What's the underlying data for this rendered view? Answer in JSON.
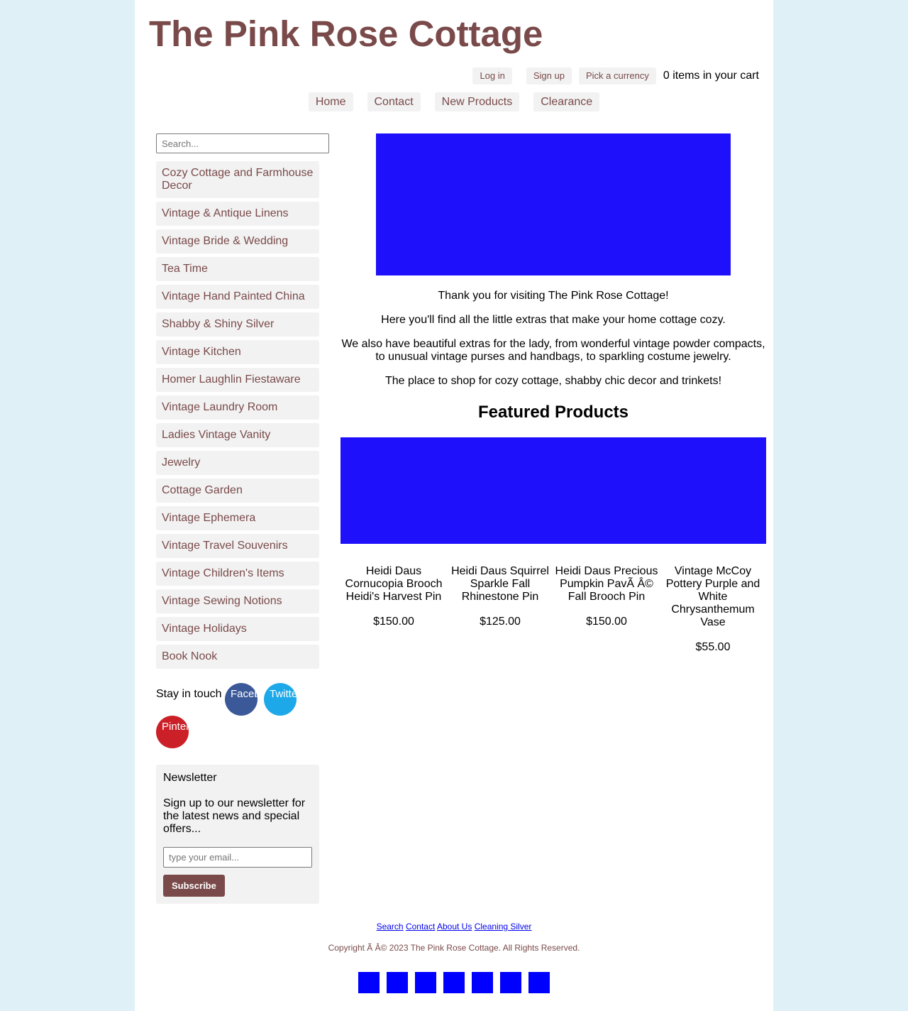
{
  "site": {
    "title": "The Pink Rose Cottage"
  },
  "topbar": {
    "login": "Log in",
    "signup": "Sign up",
    "currency": "Pick a currency",
    "cart": "0 items in your cart"
  },
  "nav": {
    "items": [
      "Home",
      "Contact",
      "New Products",
      "Clearance"
    ]
  },
  "sidebar": {
    "search_placeholder": "Search...",
    "categories": [
      "Cozy Cottage and Farmhouse Decor",
      "Vintage & Antique Linens",
      "Vintage Bride & Wedding",
      "Tea Time",
      "Vintage Hand Painted China",
      "Shabby & Shiny Silver",
      "Vintage Kitchen",
      "Homer Laughlin Fiestaware",
      "Vintage Laundry Room",
      "Ladies Vintage Vanity",
      "Jewelry",
      "Cottage Garden",
      "Vintage Ephemera",
      "Vintage Travel Souvenirs",
      "Vintage Children's Items",
      "Vintage Sewing Notions",
      "Vintage Holidays",
      "Book Nook"
    ],
    "stay_in_touch": "Stay in touch",
    "social": {
      "facebook": "Facebook",
      "twitter": "Twitter",
      "pinterest": "Pinterest"
    }
  },
  "newsletter": {
    "title": "Newsletter",
    "text": "Sign up to our newsletter for the latest news and special offers...",
    "placeholder": "type your email...",
    "button": "Subscribe"
  },
  "intro": {
    "p1": "Thank you for visiting The Pink Rose Cottage!",
    "p2": "Here you'll find all the little extras that make your home cottage cozy.",
    "p3": "We also have beautiful extras for the lady, from wonderful vintage powder compacts, to unusual vintage purses and handbags, to sparkling costume jewelry.",
    "p4": "The place to shop for cozy cottage, shabby chic decor and trinkets!"
  },
  "featured": {
    "title": "Featured Products",
    "products": [
      {
        "name": "Heidi Daus Cornucopia Brooch Heidi's Harvest Pin",
        "price": "$150.00"
      },
      {
        "name": "Heidi Daus Squirrel Sparkle Fall Rhinestone Pin",
        "price": "$125.00"
      },
      {
        "name": "Heidi Daus Precious Pumpkin PavÃ   Â© Fall Brooch Pin",
        "price": "$150.00"
      },
      {
        "name": "Vintage McCoy Pottery Purple and White Chrysanthemum Vase",
        "price": "$55.00"
      }
    ]
  },
  "footer": {
    "links": [
      "Search",
      "Contact",
      "About Us",
      "Cleaning Silver"
    ],
    "copyright": "Copyright Ã   Â© 2023 The Pink Rose Cottage. All Rights Reserved.",
    "payment_icon_count": 7
  },
  "colors": {
    "brand": "#7a4a4a",
    "page_bg": "#e0f0f7",
    "image_placeholder": "#1e10fa",
    "facebook": "#3b5998",
    "twitter": "#1da9e9",
    "pinterest": "#cb2027"
  }
}
